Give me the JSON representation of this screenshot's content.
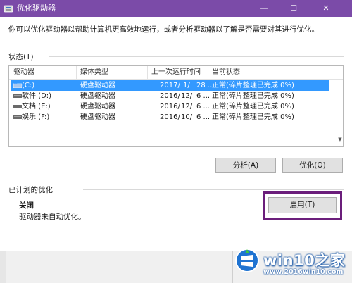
{
  "window": {
    "title": "优化驱动器",
    "minimize_glyph": "—",
    "maximize_glyph": "☐",
    "close_glyph": "✕",
    "title_bar_color": "#7b4ba8"
  },
  "intro_text": "你可以优化驱动器以帮助计算机更高效地运行，或者分析驱动器以了解是否需要对其进行优化。",
  "status": {
    "label": "状态(T)",
    "columns": [
      "驱动器",
      "媒体类型",
      "上一次运行时间",
      "当前状态"
    ],
    "drives": [
      {
        "name": "(C:)",
        "media": "硬盘驱动器",
        "year": "2017/",
        "month": "1/",
        "day": "28 ...",
        "status": "正常(碎片整理已完成 0%)",
        "icon": "windows-drive-icon",
        "selected": true
      },
      {
        "name": "软件 (D:)",
        "media": "硬盘驱动器",
        "year": "2016/",
        "month": "12/",
        "day": "6 ...",
        "status": "正常(碎片整理已完成 0%)",
        "icon": "drive-icon",
        "selected": false
      },
      {
        "name": "文档 (E:)",
        "media": "硬盘驱动器",
        "year": "2016/",
        "month": "12/",
        "day": "6 ...",
        "status": "正常(碎片整理已完成 0%)",
        "icon": "drive-icon",
        "selected": false
      },
      {
        "name": "娱乐 (F:)",
        "media": "硬盘驱动器",
        "year": "2016/",
        "month": "10/",
        "day": "6 ...",
        "status": "正常(碎片整理已完成 0%)",
        "icon": "drive-icon",
        "selected": false
      }
    ],
    "selection_color": "#3399ff"
  },
  "actions": {
    "analyze_label": "分析(A)",
    "optimize_label": "优化(O)"
  },
  "scheduled": {
    "label": "已计划的优化",
    "state": "关闭",
    "description": "驱动器未自动优化。",
    "enable_label": "启用(T)",
    "highlight_color": "#6b1e7b"
  },
  "watermark": {
    "brand": "win10之家",
    "url": "www.2016win10.com"
  }
}
